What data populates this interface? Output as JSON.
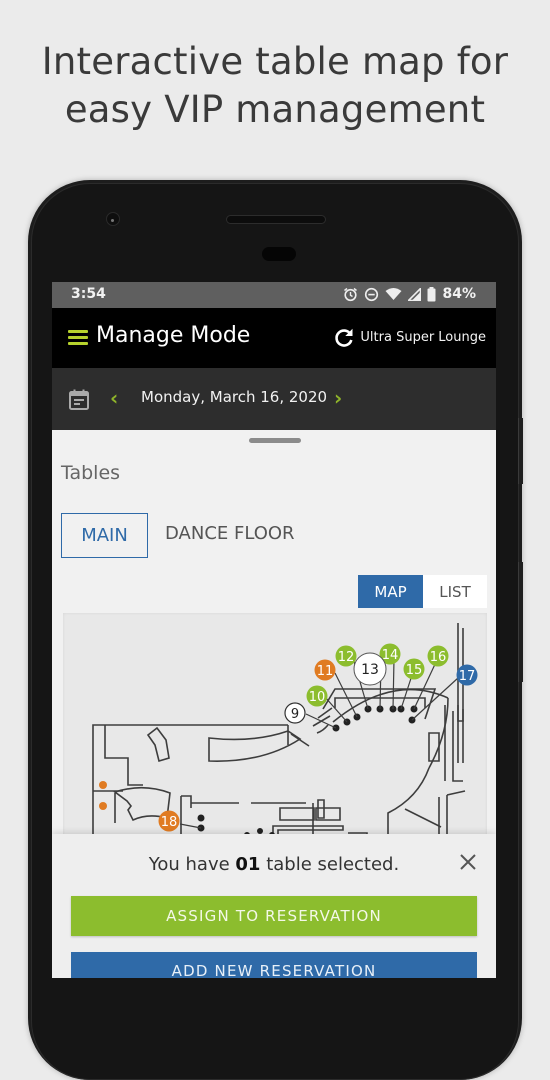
{
  "headline": {
    "line1": "Interactive table map for",
    "line2": "easy VIP management"
  },
  "status_bar": {
    "time": "3:54",
    "icons": [
      "alarm-icon",
      "do-not-disturb-icon",
      "wifi-icon",
      "signal-icon",
      "battery-icon"
    ],
    "battery": "84%"
  },
  "app_bar": {
    "title": "Manage Mode",
    "menu_icon": "hamburger-menu-icon",
    "refresh_icon": "refresh-icon",
    "venue": "Ultra Super Lounge"
  },
  "date_bar": {
    "calendar_icon": "calendar-icon",
    "prev": "‹",
    "next": "›",
    "date": "Monday, March 16, 2020"
  },
  "tables": {
    "title": "Tables",
    "tabs": [
      {
        "label": "MAIN",
        "active": true
      },
      {
        "label": "DANCE FLOOR",
        "active": false
      }
    ],
    "view_toggle": [
      {
        "label": "MAP",
        "active": true
      },
      {
        "label": "LIST",
        "active": false
      }
    ]
  },
  "map": {
    "markers": [
      {
        "number": "9",
        "status": "selected",
        "color": "#ffffff"
      },
      {
        "number": "10",
        "status": "available",
        "color": "#8cbd2e"
      },
      {
        "number": "11",
        "status": "reserved",
        "color": "#e07b22"
      },
      {
        "number": "12",
        "status": "available",
        "color": "#8cbd2e"
      },
      {
        "number": "13",
        "status": "selected",
        "color": "#ffffff"
      },
      {
        "number": "14",
        "status": "available",
        "color": "#8cbd2e"
      },
      {
        "number": "15",
        "status": "available",
        "color": "#8cbd2e"
      },
      {
        "number": "16",
        "status": "available",
        "color": "#8cbd2e"
      },
      {
        "number": "17",
        "status": "occupied",
        "color": "#2f6aa8"
      },
      {
        "number": "18",
        "status": "reserved",
        "color": "#e07b22"
      }
    ]
  },
  "selection": {
    "prefix": "You have ",
    "count": "01",
    "suffix": " table selected.",
    "close_icon": "close-icon"
  },
  "actions": {
    "assign": "ASSIGN TO RESERVATION",
    "add_new": "ADD NEW RESERVATION"
  },
  "colors": {
    "accent_green": "#8cbd2e",
    "accent_blue": "#2f6aa8",
    "accent_orange": "#e07b22"
  }
}
